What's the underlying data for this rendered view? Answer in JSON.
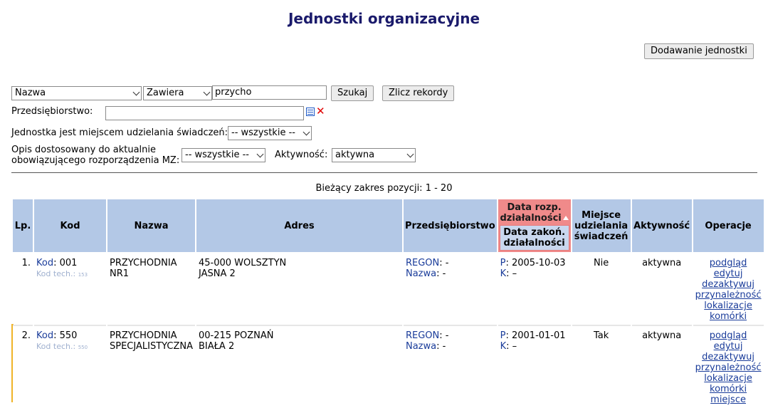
{
  "page": {
    "title": "Jednostki organizacyjne",
    "add_button": "Dodawanie jednostki"
  },
  "filters": {
    "field_select": "Nazwa",
    "operator_select": "Zawiera",
    "search_value": "przycho",
    "search_button": "Szukaj",
    "count_button": "Zlicz rekordy",
    "enterprise_label": "Przedsiębiorstwo:",
    "enterprise_value": "",
    "place_label": "Jednostka jest miejscem udzielania świadczeń:",
    "place_select": "-- wszystkie --",
    "desc_label_line1": "Opis dostosowany do aktualnie",
    "desc_label_line2": "obowiązującego rozporządzenia MZ:",
    "desc_select": "-- wszystkie --",
    "activity_label": "Aktywność:",
    "activity_select": "aktywna"
  },
  "range_text": "Bieżący zakres pozycji: 1 - 20",
  "table": {
    "headers": {
      "lp": "Lp.",
      "kod": "Kod",
      "nazwa": "Nazwa",
      "adres": "Adres",
      "przeds": "Przedsiębiorstwo",
      "data_rozp_1": "Data rozp.",
      "data_rozp_2": "działalności",
      "data_zakon_1": "Data zakoń.",
      "data_zakon_2": "działalności",
      "miejsce_1": "Miejsce",
      "miejsce_2": "udzielania",
      "miejsce_3": "świadczeń",
      "aktywnosc": "Aktywność",
      "operacje": "Operacje"
    },
    "rows": [
      {
        "lp": "1.",
        "kod_label": "Kod",
        "kod_value": ": 001",
        "kod_tech_label": "Kod tech.:",
        "kod_tech_value": "153",
        "nazwa_1": "PRZYCHODNIA",
        "nazwa_2": "NR1",
        "adres_1": "45-000 WOLSZTYN",
        "adres_2": "JASNA 2",
        "regon_label": "REGON",
        "regon_value": ": -",
        "nazwa_label": "Nazwa",
        "nazwa_value": ": -",
        "p_label": "P",
        "p_value": ": 2005-10-03",
        "k_label": "K",
        "k_value": ": –",
        "miejsce": "Nie",
        "aktywnosc": "aktywna",
        "ops": [
          "podgląd",
          "edytuj",
          "dezaktywuj",
          "przynależność",
          "lokalizacje",
          "komórki"
        ]
      },
      {
        "lp": "2.",
        "kod_label": "Kod",
        "kod_value": ": 550",
        "kod_tech_label": "Kod tech.:",
        "kod_tech_value": "550",
        "nazwa_1": "PRZYCHODNIA",
        "nazwa_2": "SPECJALISTYCZNA",
        "adres_1": "00-215 POZNAŃ",
        "adres_2": "BIAŁA 2",
        "regon_label": "REGON",
        "regon_value": ": -",
        "nazwa_label": "Nazwa",
        "nazwa_value": ": -",
        "p_label": "P",
        "p_value": ": 2001-01-01",
        "k_label": "K",
        "k_value": ": –",
        "miejsce": "Tak",
        "aktywnosc": "aktywna",
        "ops": [
          "podgląd",
          "edytuj",
          "dezaktywuj",
          "przynależność",
          "lokalizacje",
          "komórki",
          "miejsce"
        ]
      }
    ]
  },
  "colors": {
    "header_bg": "#b3c8e6",
    "sorted_header_bg": "#f08a8a",
    "link": "#1a3c9a",
    "title": "#1a1a6b",
    "row_marker": "#f0b429"
  }
}
